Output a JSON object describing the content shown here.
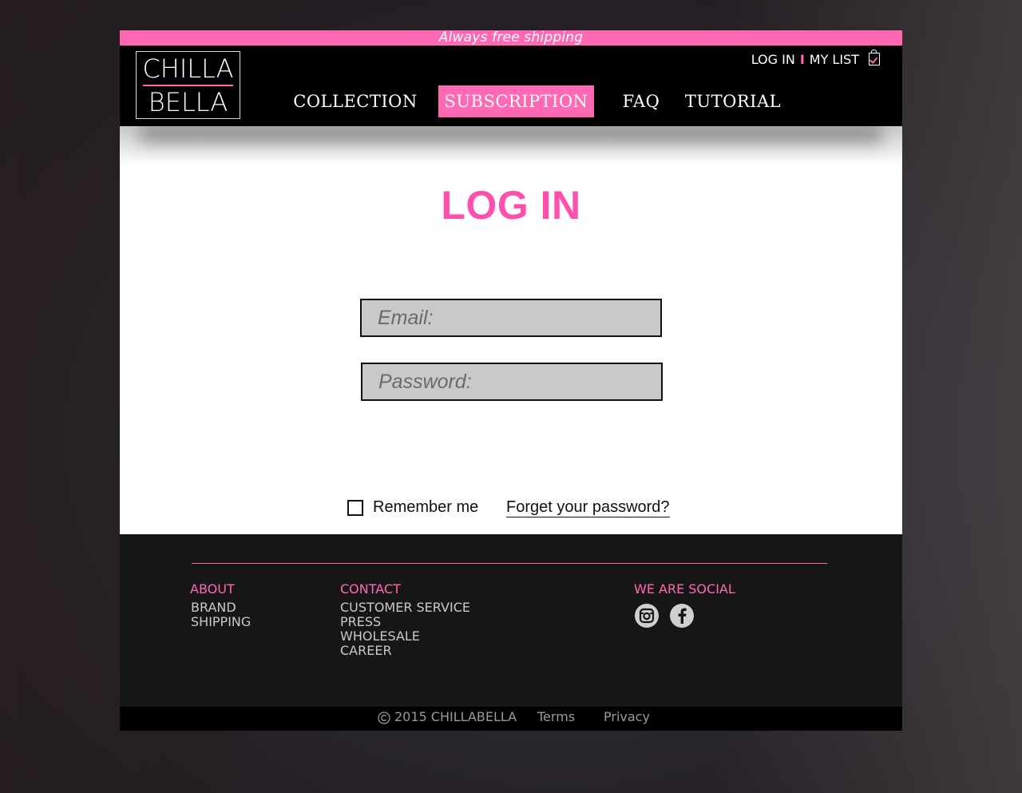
{
  "promo": {
    "text": "Always free shipping"
  },
  "header": {
    "logo": {
      "line1": "CHILLA",
      "line2": "BELLA"
    },
    "top_links": {
      "login": "LOG IN",
      "separator": "I",
      "my_list": "MY LIST",
      "bag_icon": "shopping-bag-check-icon"
    },
    "nav": [
      {
        "label": "COLLECTION",
        "active": false
      },
      {
        "label": "SUBSCRIPTION",
        "active": true
      },
      {
        "label": "FAQ",
        "active": false
      },
      {
        "label": "TUTORIAL",
        "active": false
      }
    ]
  },
  "main": {
    "title": "LOG IN",
    "email": {
      "placeholder": "Email:",
      "value": ""
    },
    "password": {
      "placeholder": "Password:",
      "value": ""
    },
    "remember_label": "Remember me",
    "remember_checked": false,
    "forgot_link": "Forget your password?"
  },
  "footer": {
    "about": {
      "heading": "ABOUT",
      "links": [
        "BRAND",
        "SHIPPING"
      ]
    },
    "contact": {
      "heading": "CONTACT",
      "links": [
        "CUSTOMER SERVICE",
        "PRESS",
        "WHOLESALE",
        "CAREER"
      ]
    },
    "social": {
      "heading": "WE ARE SOCIAL",
      "icons": [
        "instagram-icon",
        "facebook-icon"
      ]
    },
    "copyright": "2015 CHILLABELLA",
    "copyright_icon": "copyright-icon",
    "terms": "Terms",
    "privacy": "Privacy"
  },
  "colors": {
    "accent": "#ff69b4",
    "title": "#ff4fae",
    "header_bg": "#000000",
    "footer_bg": "#161616",
    "field_bg": "#c9c9c9"
  }
}
